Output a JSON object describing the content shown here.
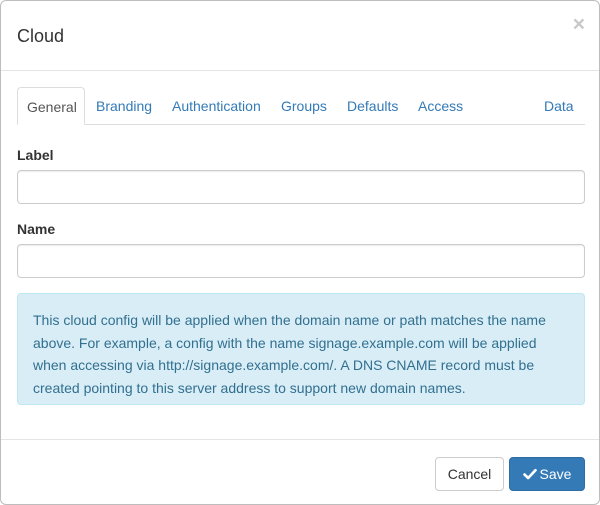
{
  "dialog": {
    "title": "Cloud",
    "close_symbol": "×",
    "close_icon": "close-icon"
  },
  "tabs": [
    {
      "label": "General",
      "active": true
    },
    {
      "label": "Branding",
      "active": false
    },
    {
      "label": "Authentication",
      "active": false
    },
    {
      "label": "Groups",
      "active": false
    },
    {
      "label": "Defaults",
      "active": false
    },
    {
      "label": "Access",
      "active": false
    },
    {
      "label": "Data",
      "active": false
    }
  ],
  "form": {
    "label_field": {
      "label": "Label",
      "value": "",
      "placeholder": ""
    },
    "name_field": {
      "label": "Name",
      "value": "",
      "placeholder": ""
    }
  },
  "info_alert": {
    "text": "This cloud config will be applied when the domain name or path matches the name above. For example, a config with the name signage.example.com will be applied when accessing via http://signage.example.com/. A DNS CNAME record must be created pointing to this server address to support new domain names."
  },
  "footer": {
    "cancel_label": "Cancel",
    "save_label": "Save",
    "save_icon": "check-icon"
  },
  "colors": {
    "link": "#337ab7",
    "primary": "#337ab7",
    "alert_bg": "#d9edf7",
    "alert_text": "#31708f"
  }
}
